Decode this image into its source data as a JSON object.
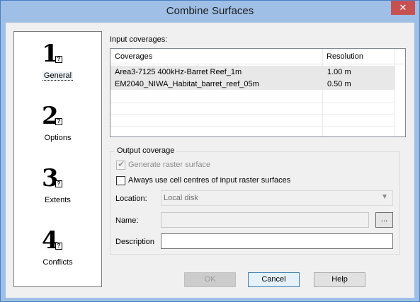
{
  "window": {
    "title": "Combine Surfaces",
    "close_glyph": "✕"
  },
  "steps": [
    {
      "number": "1",
      "label": "General",
      "active": true
    },
    {
      "number": "2",
      "label": "Options",
      "active": false
    },
    {
      "number": "3",
      "label": "Extents",
      "active": false
    },
    {
      "number": "4",
      "label": "Conflicts",
      "active": false
    }
  ],
  "step_help_glyph": "?",
  "input": {
    "label": "Input coverages:",
    "columns": [
      "Coverages",
      "Resolution"
    ],
    "rows": [
      {
        "coverage": "Area3-7125 400kHz-Barret Reef_1m",
        "resolution": "1.00 m"
      },
      {
        "coverage": "EM2040_NIWA_Habitat_barret_reef_05m",
        "resolution": "0.50 m"
      }
    ]
  },
  "output": {
    "group_label": "Output coverage",
    "generate_raster_label": "Generate raster surface",
    "generate_raster_checked": true,
    "cell_centres_label": "Always use cell centres of input raster surfaces",
    "cell_centres_checked": false,
    "location_label": "Location:",
    "location_value": "Local disk",
    "name_label": "Name:",
    "name_value": "",
    "browse_label": "...",
    "description_label": "Description",
    "description_value": ""
  },
  "buttons": {
    "ok": "OK",
    "cancel": "Cancel",
    "help": "Help"
  }
}
